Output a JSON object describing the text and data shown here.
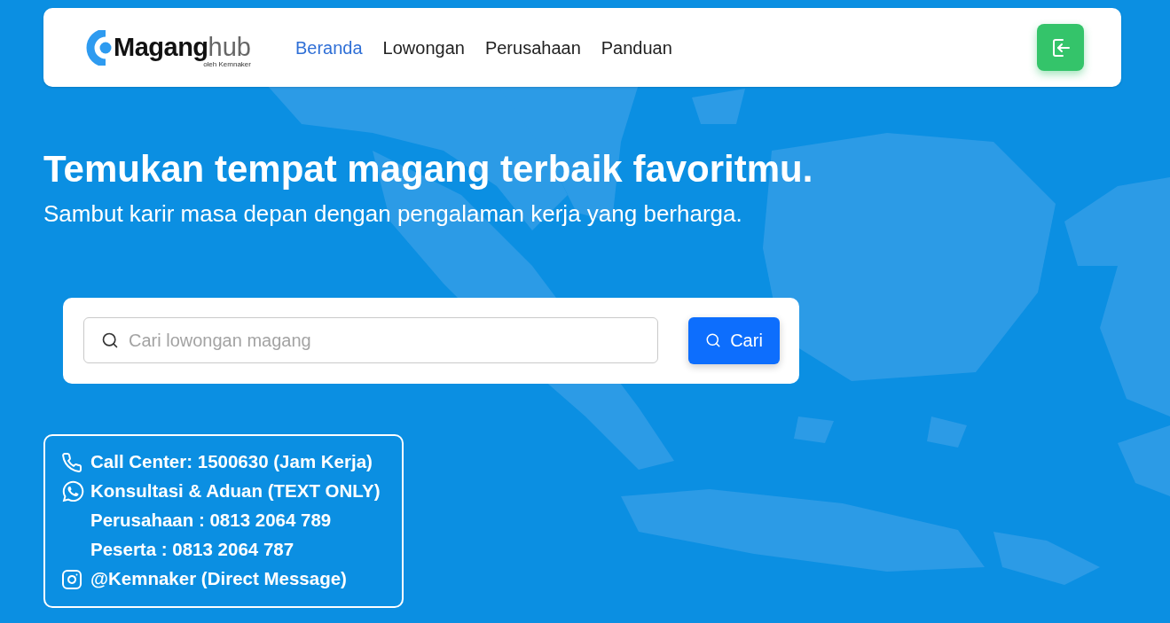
{
  "navbar": {
    "logo": {
      "primary": "Magang",
      "secondary": "hub",
      "tagline": "oleh Kemnaker"
    },
    "links": [
      {
        "label": "Beranda",
        "selected": true
      },
      {
        "label": "Lowongan",
        "selected": false
      },
      {
        "label": "Perusahaan",
        "selected": false
      },
      {
        "label": "Panduan",
        "selected": false
      }
    ]
  },
  "hero": {
    "title": "Temukan tempat magang terbaik favoritmu.",
    "subtitle": "Sambut karir masa depan dengan pengalaman kerja yang berharga."
  },
  "search": {
    "placeholder": "Cari lowongan magang",
    "button": "Cari"
  },
  "contact": {
    "lines": [
      {
        "kind": "phone",
        "text": "Call Center: 1500630 (Jam Kerja)"
      },
      {
        "kind": "whatsapp",
        "text": "Konsultasi & Aduan (TEXT ONLY)"
      },
      {
        "kind": "plain",
        "text": "Perusahaan : 0813 2064 789"
      },
      {
        "kind": "plain",
        "text": "Peserta : 0813 2064 787"
      },
      {
        "kind": "instagram",
        "text": "@Kemnaker (Direct Message)"
      }
    ]
  }
}
